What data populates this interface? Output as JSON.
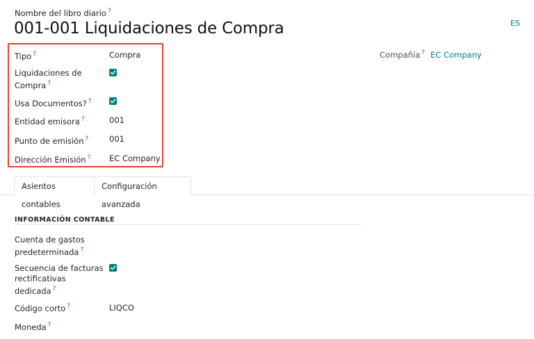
{
  "header": {
    "name_label": "Nombre del libro diario",
    "title": "001-001 Liquidaciones de Compra",
    "lang": "ES"
  },
  "fields": {
    "tipo": {
      "label": "Tipo",
      "value": "Compra"
    },
    "liquidaciones": {
      "label_line1": "Liquidaciones de",
      "label_line2": "Compra",
      "checked": true
    },
    "usa_documentos": {
      "label": "Usa Documentos?",
      "checked": true
    },
    "entidad": {
      "label": "Entidad emisora",
      "value": "001"
    },
    "punto": {
      "label": "Punto de emisión",
      "value": "001"
    },
    "direccion": {
      "label": "Dirección Emisión",
      "value": "EC Company"
    }
  },
  "company": {
    "label": "Compañía",
    "value": "EC Company"
  },
  "tabs": [
    {
      "label": "Asientos contables",
      "active": true
    },
    {
      "label": "Configuración avanzada",
      "active": false
    }
  ],
  "accounting": {
    "section_title": "INFORMACIÓN CONTABLE",
    "cuenta": {
      "label_line1": "Cuenta de gastos",
      "label_line2": "predeterminada"
    },
    "secuencia": {
      "label_line1": "Secuencia de facturas",
      "label_line2": "rectificativas",
      "label_line3": "dedicada",
      "checked": true
    },
    "codigo": {
      "label": "Código corto",
      "value": "LIQCO"
    },
    "moneda": {
      "label": "Moneda"
    }
  },
  "help_mark": "?",
  "colors": {
    "accent": "#017e84",
    "highlight": "#e8402f"
  }
}
